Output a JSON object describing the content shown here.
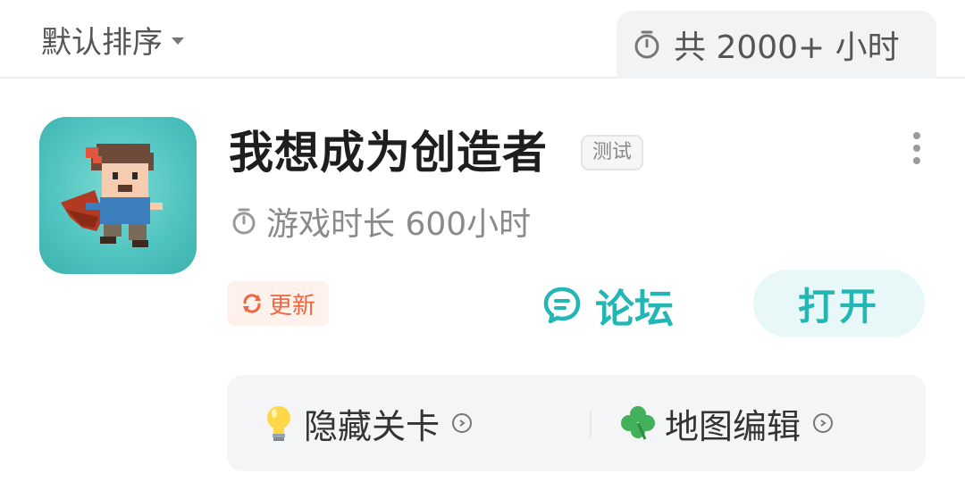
{
  "header": {
    "sort_label": "默认排序",
    "total_label": "共 2000+ 小时",
    "icons": {
      "sort": "caret-down-icon",
      "total": "stopwatch-icon"
    }
  },
  "game": {
    "title": "我想成为创造者",
    "tag": "测试",
    "playtime": "游戏时长 600小时",
    "update_label": "更新",
    "forum_label": "论坛",
    "open_label": "打开",
    "colors": {
      "accent": "#22b6b4",
      "update": "#f1663c",
      "icon_bg": "#4ec3bf"
    }
  },
  "features": [
    {
      "label": "隐藏关卡",
      "icon": "lightbulb-icon"
    },
    {
      "label": "地图编辑",
      "icon": "clover-icon"
    }
  ]
}
